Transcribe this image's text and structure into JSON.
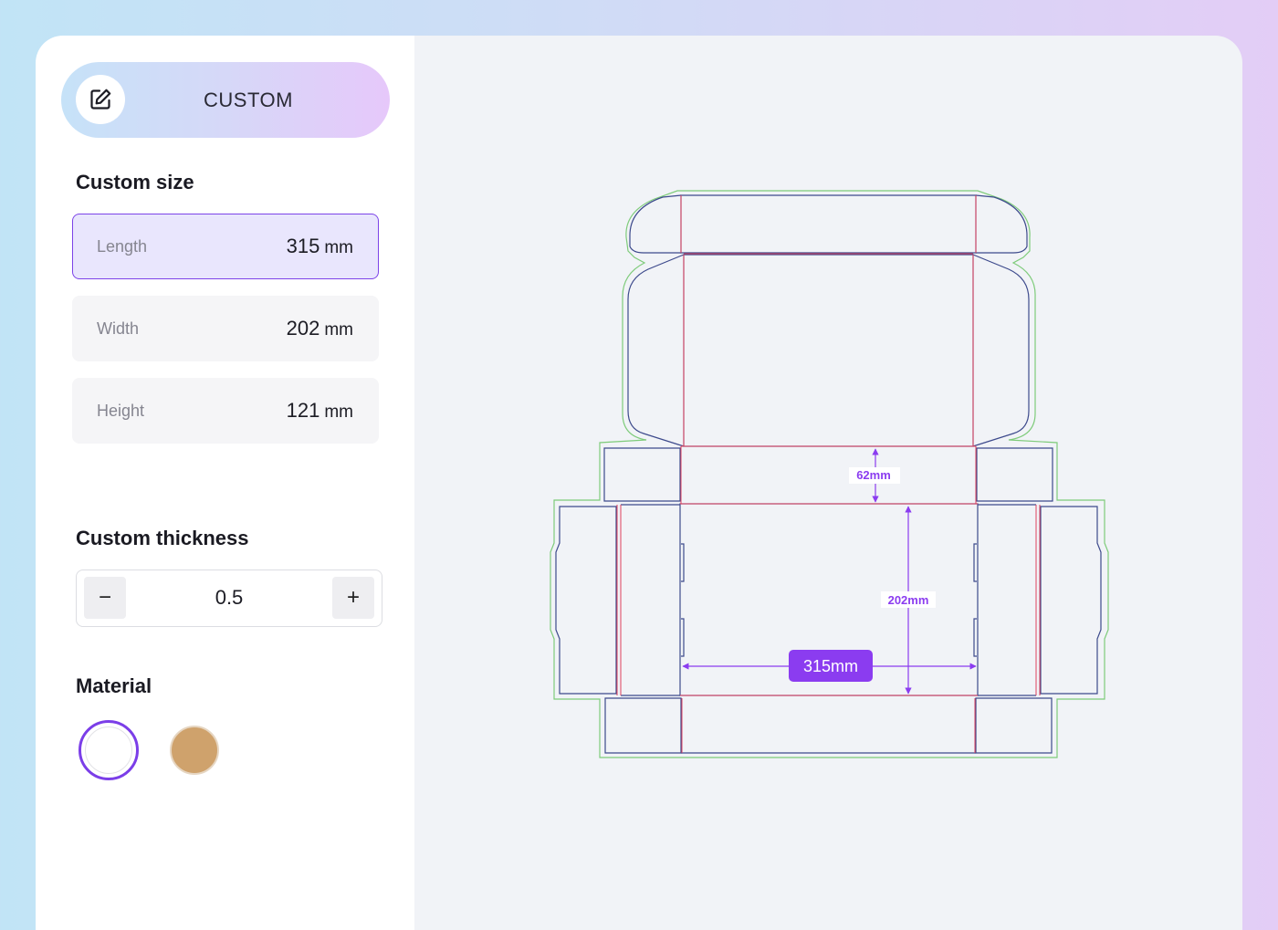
{
  "mode": {
    "label": "CUSTOM",
    "icon": "edit-icon"
  },
  "custom_size": {
    "title": "Custom size",
    "fields": [
      {
        "label": "Length",
        "value": "315",
        "unit": "mm",
        "active": true
      },
      {
        "label": "Width",
        "value": "202",
        "unit": "mm",
        "active": false
      },
      {
        "label": "Height",
        "value": "121",
        "unit": "mm",
        "active": false
      }
    ]
  },
  "custom_thickness": {
    "title": "Custom thickness",
    "value": "0.5",
    "decrement_label": "−",
    "increment_label": "+"
  },
  "material": {
    "title": "Material",
    "options": [
      {
        "name": "white",
        "color": "#ffffff",
        "selected": true
      },
      {
        "name": "kraft",
        "color": "#cfa26c",
        "selected": false
      }
    ]
  },
  "dieline": {
    "colors": {
      "cut": "#3d4a8c",
      "fold": "#e0405c",
      "bleed": "#7ecb7a",
      "dimension": "#8b3cf0"
    },
    "dimensions": {
      "length": "315mm",
      "width": "202mm",
      "height": "62mm"
    }
  }
}
